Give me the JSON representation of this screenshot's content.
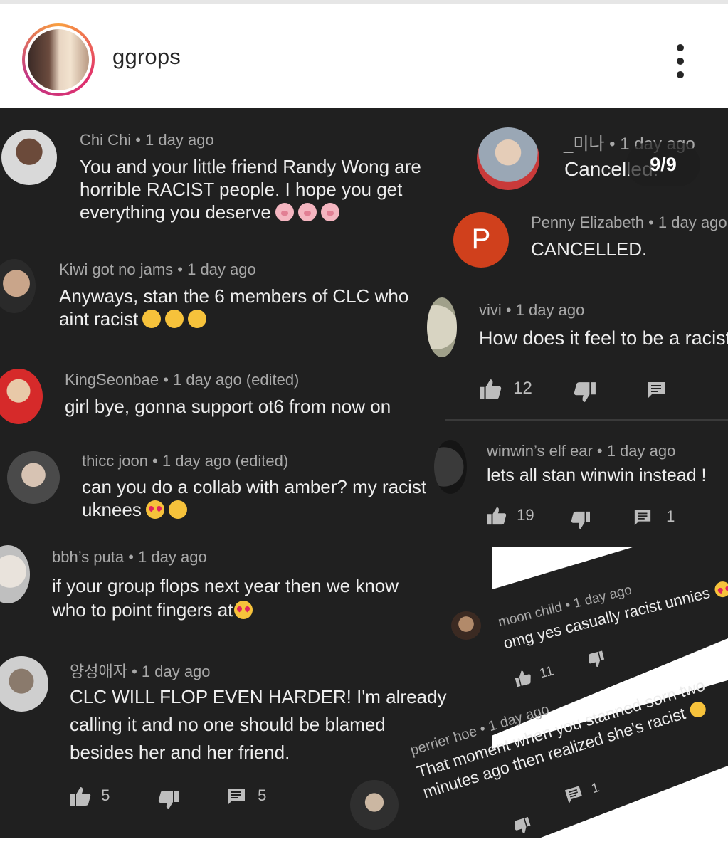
{
  "header": {
    "username": "ggrops"
  },
  "carousel": {
    "counter": "9/9"
  },
  "left_comments": [
    {
      "author_time": "Chi Chi • 1 day ago",
      "lines": [
        "You and your little friend Randy Wong are",
        "horrible RACIST people. I hope you get",
        "everything you deserve"
      ],
      "emoji": "pig-emoji x3"
    },
    {
      "author_time": "Kiwi got no jams • 1 day ago",
      "lines": [
        "Anyways, stan the 6 members of CLC who",
        "aint racist"
      ],
      "emoji": "star-struck-emoji x3"
    },
    {
      "author_time": "KingSeonbae • 1 day ago (edited)",
      "lines": [
        "girl bye, gonna support ot6 from now on"
      ]
    },
    {
      "author_time": "thicc joon • 1 day ago (edited)",
      "lines": [
        "can you do a collab with amber? my racist",
        "uknees"
      ],
      "emoji": "heart-eyes-emoji, tired-face-emoji"
    },
    {
      "author_time": "bbh’s puta • 1 day ago",
      "lines": [
        "if your group flops next year then we know",
        "who to point fingers at"
      ],
      "emoji": "heart-eyes-emoji"
    },
    {
      "author_time": "양성애자 • 1 day ago",
      "lines": [
        "CLC WILL FLOP EVEN HARDER! I'm already",
        "calling it and no one should be blamed",
        "besides her and her friend."
      ],
      "likes": "5",
      "replies": "5"
    }
  ],
  "right_comments": [
    {
      "author_time": "_미나 • 1 day ago",
      "text": "Cancelled."
    },
    {
      "avatar_letter": "P",
      "author_time": "Penny Elizabeth • 1 day ago",
      "text": "CANCELLED."
    },
    {
      "author_time": "vivi • 1 day ago",
      "text": "How does it feel to be a racist",
      "likes": "12"
    },
    {
      "author_time": "winwin’s elf ear • 1 day ago",
      "text": "lets all stan winwin instead !",
      "likes": "19",
      "replies": "1"
    },
    {
      "author_time": "moon child • 1 day ago",
      "text": "omg yes casually racist unnies",
      "likes": "11"
    },
    {
      "author_time": "perrier hoe • 1 day ago",
      "lines": [
        "That moment when you stanned sorn two",
        "minutes ago then realized she's racist"
      ],
      "replies": "1"
    }
  ],
  "colors": {
    "post_bg": "#202020",
    "text": "#ededed",
    "meta": "#a8a8a8",
    "penny_avatar": "#d0401c"
  }
}
